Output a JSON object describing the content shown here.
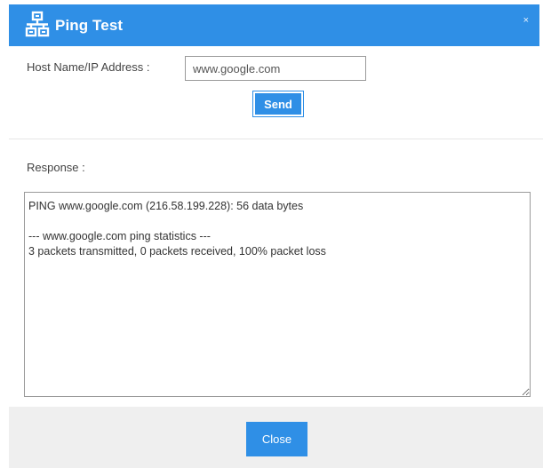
{
  "dialog": {
    "title": "Ping Test",
    "close_glyph": "×",
    "title_icon": "network-icon",
    "accent_color": "#2f8fe6"
  },
  "form": {
    "host_label": "Host Name/IP Address :",
    "host_value": "www.google.com",
    "send_label": "Send"
  },
  "response": {
    "label": "Response :",
    "text": "PING www.google.com (216.58.199.228): 56 data bytes\n\n--- www.google.com ping statistics ---\n3 packets transmitted, 0 packets received, 100% packet loss"
  },
  "footer": {
    "close_label": "Close"
  }
}
